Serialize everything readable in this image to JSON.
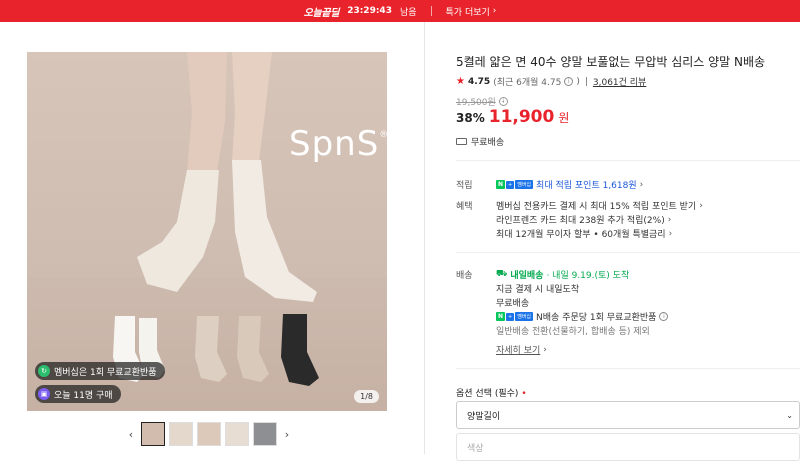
{
  "topbar": {
    "brand": "오늘끝딜",
    "timer": "23:29:43",
    "timer_suffix": "남음",
    "more_label": "특가 더보기",
    "more_chevron": "›"
  },
  "gallery": {
    "brand_logo": "SpnS",
    "brand_mark": "®",
    "badge_membership": "멤버십은 1회 무료교환반품",
    "badge_purchases": "오늘 11명 구매",
    "counter": "1/8",
    "prev_arrow": "‹",
    "next_arrow": "›",
    "thumb_count": 5
  },
  "product": {
    "title": "5켤레 얇은 면 40수 양말 보풀없는 무압박 심리스 양말 N배송",
    "rating_score": "4.75",
    "rating_detail": "(최근 6개월 4.75",
    "rating_detail_close": ")",
    "review_count": "3,061건 리뷰",
    "original_price": "19,500원",
    "discount": "38%",
    "price": "11,900",
    "price_unit": "원",
    "shipping_summary": "무료배송"
  },
  "benefits": {
    "points_label": "적립",
    "points_text": "최대 적립 포인트 1,618원",
    "benefit_label": "혜택",
    "benefit_lines": [
      "멤버십 전용카드 결제 시 최대 15% 적립 포인트 받기",
      "라인프렌즈 카드 최대 238원 추가 적립(2%)",
      "최대 12개월 무이자 할부 • 60개월 특별금리"
    ]
  },
  "delivery": {
    "label": "배송",
    "tomorrow_badge": "내일배송",
    "tomorrow_date": "· 내일 9.19.(토) 도착",
    "line1": "지금 결제 시 내일도착",
    "line2": "무료배송",
    "npay_return": "N배송 주문당 1회 무료교환반품",
    "line4": "일반배송 전환(선물하기, 합배송 등) 제외",
    "more_link": "자세히 보기"
  },
  "badges": {
    "n_label": "N",
    "plus_label": "+",
    "membership_label": "멤버십"
  },
  "options": {
    "label": "옵션 선택 (필수)",
    "required_mark": "•",
    "select1_value": "양말길이",
    "select2_placeholder": "색상",
    "caret": "⌄"
  },
  "colors": {
    "accent_red": "#e8232b",
    "naver_green": "#03c75a",
    "link_blue": "#1a55d6"
  }
}
